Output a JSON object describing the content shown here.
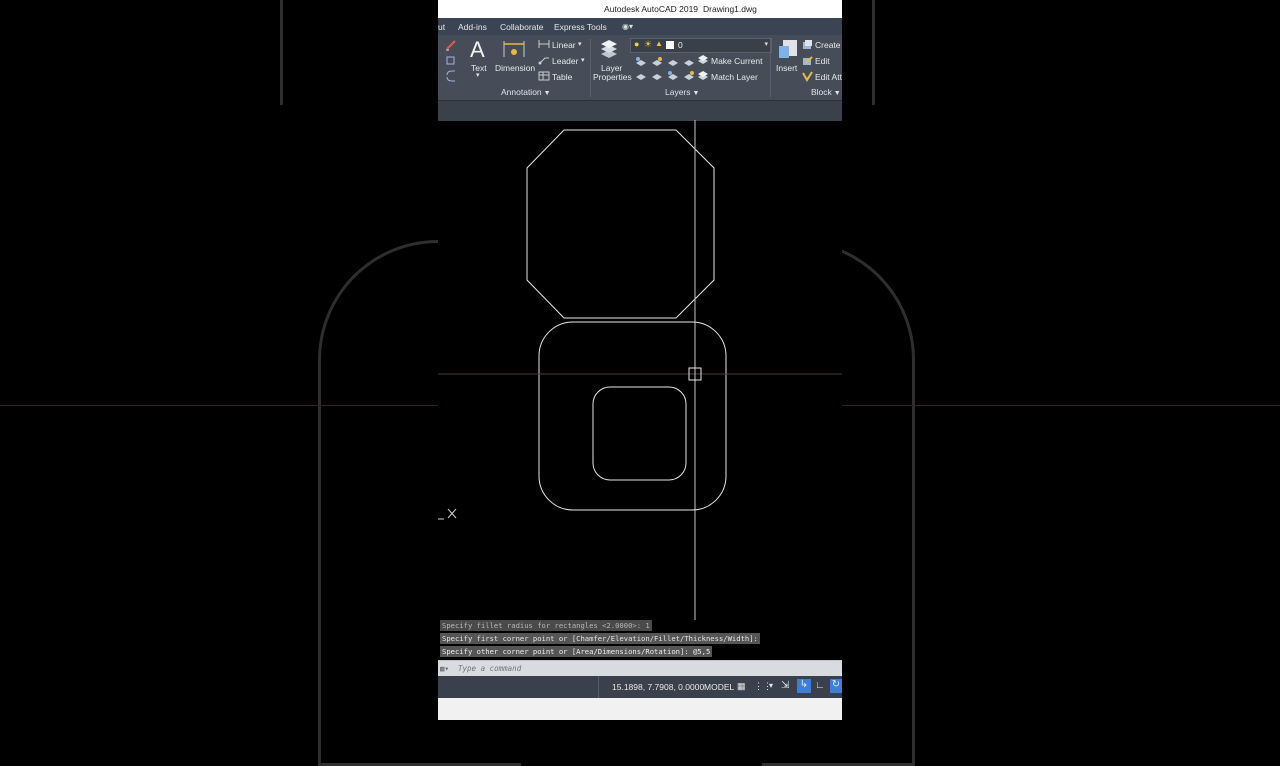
{
  "titlebar": {
    "app_title": "Autodesk AutoCAD 2019",
    "document": "Drawing1.dwg"
  },
  "tabs": [
    "ut",
    "Add-ins",
    "Collaborate",
    "Express Tools"
  ],
  "tab_extra_icon": "video-camera-icon",
  "ribbon": {
    "text_label": "Text",
    "dimension_label": "Dimension",
    "linear_label": "Linear",
    "leader_label": "Leader",
    "table_label": "Table",
    "annotation_panel": "Annotation",
    "layer_properties_label": "Layer\nProperties",
    "layer_current": "0",
    "make_current_label": "Make Current",
    "match_layer_label": "Match Layer",
    "layers_panel": "Layers",
    "insert_label": "Insert",
    "create_label": "Create",
    "edit_label": "Edit",
    "edit_attr_label": "Edit Att",
    "block_panel": "Block"
  },
  "command": {
    "history": [
      "Specify fillet radius for rectangles <2.0000>: 1",
      "Specify first corner point or [Chamfer/Elevation/Fillet/Thickness/Width]:",
      "Specify other corner point or [Area/Dimensions/Rotation]: @5,5"
    ],
    "placeholder": "Type a command"
  },
  "status": {
    "coordinates": "15.1898, 7.7908, 0.0000",
    "mode": "MODEL"
  },
  "colors": {
    "ribbon": "#464d59",
    "tabs": "#3b4453",
    "canvas": "#000000",
    "crosshair": "#c8c8c8",
    "crosshair_h": "#5a3a30",
    "status_active": "#3d7fd6"
  }
}
